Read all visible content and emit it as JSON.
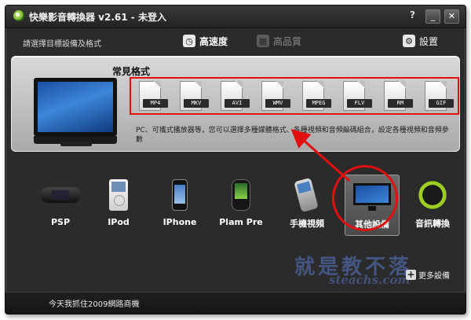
{
  "window": {
    "title": "快樂影音轉換器 v2.61 - 未登入",
    "help_label": "?",
    "minimize_label": "_",
    "close_label": "✕"
  },
  "toolbar": {
    "hint": "請選擇目標設備及格式",
    "fast_mode": "高速度",
    "hq_mode": "高品質",
    "settings": "設置"
  },
  "formats_panel": {
    "title": "常見格式",
    "formats": [
      "MP4",
      "MKV",
      "AVI",
      "WMV",
      "MPEG",
      "FLV",
      "RM",
      "GIF"
    ],
    "description": "PC、可攜式播放器等，您可以選擇多種媒體格式、各種視頻和音頻編碼組合，設定各種視頻和音頻參數"
  },
  "devices": [
    {
      "label": "PSP",
      "icon": "psp-icon"
    },
    {
      "label": "IPod",
      "icon": "ipod-icon"
    },
    {
      "label": "IPhone",
      "icon": "iphone-icon"
    },
    {
      "label": "Plam Pre",
      "icon": "palm-pre-icon"
    },
    {
      "label": "手機視頻",
      "icon": "mobile-phone-icon"
    },
    {
      "label": "其他設備",
      "icon": "monitor-icon",
      "selected": true
    },
    {
      "label": "音訊轉換",
      "icon": "headphones-icon"
    }
  ],
  "more_devices": "更多設備",
  "watermark": {
    "text": "就是教不落",
    "sub": "steachs.com"
  },
  "status": "今天我抓住2009網路商機",
  "colors": {
    "annotation_red": "#e01010",
    "window_bg": "#2b2b2b"
  }
}
